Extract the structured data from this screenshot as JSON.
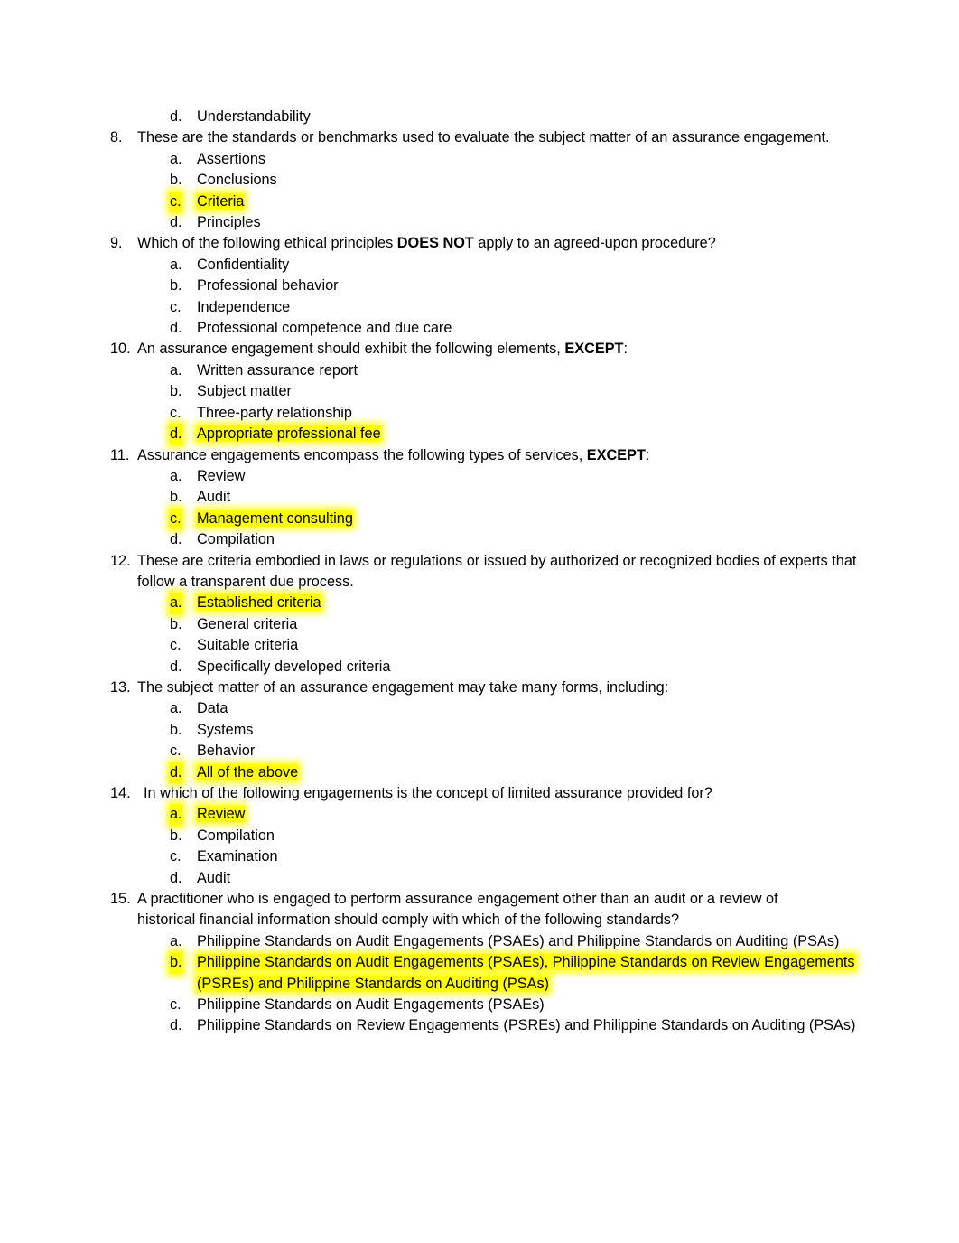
{
  "document": {
    "type": "multiple-choice-quiz",
    "topic": "Assurance Engagements",
    "highlight_color": "#ffff00",
    "page_background": "#ffffff",
    "text_color": "#000000"
  },
  "orphan_option": {
    "letter": "d.",
    "text": "Understandability",
    "highlighted": false
  },
  "questions": [
    {
      "number": "8.",
      "text_parts": [
        {
          "text": "These are the standards or benchmarks used to evaluate the subject matter of an assurance engagement.",
          "bold": false
        }
      ],
      "justified": false,
      "options": [
        {
          "letter": "a.",
          "text": "Assertions",
          "highlighted": false
        },
        {
          "letter": "b.",
          "text": "Conclusions",
          "highlighted": false
        },
        {
          "letter": "c.",
          "text": "Criteria",
          "highlighted": true
        },
        {
          "letter": "d.",
          "text": "Principles",
          "highlighted": false
        }
      ]
    },
    {
      "number": "9.",
      "text_parts": [
        {
          "text": "Which of the following ethical principles ",
          "bold": false
        },
        {
          "text": "DOES NOT",
          "bold": true
        },
        {
          "text": " apply to an agreed-upon procedure?",
          "bold": false
        }
      ],
      "justified": false,
      "options": [
        {
          "letter": "a.",
          "text": "Confidentiality",
          "highlighted": false
        },
        {
          "letter": "b.",
          "text": "Professional behavior",
          "highlighted": false
        },
        {
          "letter": "c.",
          "text": "Independence",
          "highlighted": false
        },
        {
          "letter": "d.",
          "text": "Professional competence and due care",
          "highlighted": false
        }
      ]
    },
    {
      "number": "10.",
      "text_parts": [
        {
          "text": "An assurance engagement should exhibit the following elements, ",
          "bold": false
        },
        {
          "text": "EXCEPT",
          "bold": true
        },
        {
          "text": ":",
          "bold": false
        }
      ],
      "justified": false,
      "options": [
        {
          "letter": "a.",
          "text": "Written assurance report",
          "highlighted": false
        },
        {
          "letter": "b.",
          "text": "Subject matter",
          "highlighted": false
        },
        {
          "letter": "c.",
          "text": "Three-party relationship",
          "highlighted": false
        },
        {
          "letter": "d.",
          "text": "Appropriate professional fee",
          "highlighted": true
        }
      ]
    },
    {
      "number": "11.",
      "text_parts": [
        {
          "text": "Assurance engagements encompass the following types of services, ",
          "bold": false
        },
        {
          "text": "EXCEPT",
          "bold": true
        },
        {
          "text": ":",
          "bold": false
        }
      ],
      "justified": false,
      "options": [
        {
          "letter": "a.",
          "text": "Review",
          "highlighted": false
        },
        {
          "letter": "b.",
          "text": "Audit",
          "highlighted": false
        },
        {
          "letter": "c.",
          "text": "Management consulting",
          "highlighted": true
        },
        {
          "letter": "d.",
          "text": "Compilation",
          "highlighted": false
        }
      ]
    },
    {
      "number": "12.",
      "text_parts": [
        {
          "text": "These are criteria embodied in laws or regulations or issued by authorized or recognized bodies of experts that follow a transparent due process.",
          "bold": false
        }
      ],
      "justified": false,
      "options": [
        {
          "letter": "a.",
          "text": "Established criteria",
          "highlighted": true
        },
        {
          "letter": "b.",
          "text": "General criteria",
          "highlighted": false
        },
        {
          "letter": "c.",
          "text": "Suitable criteria",
          "highlighted": false
        },
        {
          "letter": "d.",
          "text": "Specifically developed criteria",
          "highlighted": false
        }
      ]
    },
    {
      "number": "13.",
      "text_parts": [
        {
          "text": "The subject matter of an assurance engagement may take many forms, including:",
          "bold": false
        }
      ],
      "justified": false,
      "options": [
        {
          "letter": "a.",
          "text": "Data",
          "highlighted": false
        },
        {
          "letter": "b.",
          "text": "Systems",
          "highlighted": false
        },
        {
          "letter": "c.",
          "text": "Behavior",
          "highlighted": false
        },
        {
          "letter": "d.",
          "text": "All of the above",
          "highlighted": true
        }
      ]
    },
    {
      "number": "14.",
      "text_parts": [
        {
          "text": "In which of the following engagements is the concept of limited assurance provided for?",
          "bold": false
        }
      ],
      "justified": false,
      "wide_number": true,
      "options": [
        {
          "letter": "a.",
          "text": "Review",
          "highlighted": true
        },
        {
          "letter": "b.",
          "text": "Compilation",
          "highlighted": false
        },
        {
          "letter": "c.",
          "text": "Examination",
          "highlighted": false
        },
        {
          "letter": "d.",
          "text": "Audit",
          "highlighted": false
        }
      ]
    },
    {
      "number": "15.",
      "text_parts": [
        {
          "text": "A practitioner who is engaged to perform assurance engagement other than an audit or a review of",
          "bold": false
        }
      ],
      "text_lastline": "historical financial information should comply with which of the following standards?",
      "justified": true,
      "options": [
        {
          "letter": "a.",
          "text": "Philippine Standards on Audit Engagements (PSAEs) and Philippine Standards on Auditing (PSAs)",
          "highlighted": false
        },
        {
          "letter": "b.",
          "text": "Philippine Standards on Audit Engagements (PSAEs), Philippine Standards on Review Engagements (PSREs) and Philippine Standards on Auditing (PSAs)",
          "highlighted": true
        },
        {
          "letter": "c.",
          "text": "Philippine Standards on Audit Engagements (PSAEs)",
          "highlighted": false
        },
        {
          "letter": "d.",
          "text": "Philippine Standards on Review Engagements (PSREs) and Philippine Standards on Auditing (PSAs)",
          "highlighted": false
        }
      ]
    }
  ]
}
